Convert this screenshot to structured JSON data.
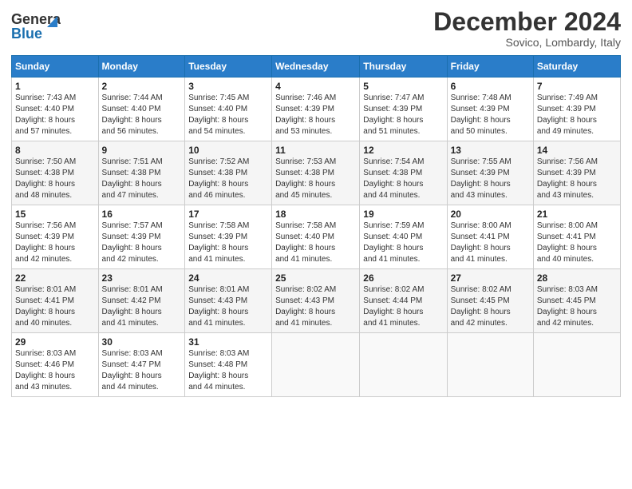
{
  "header": {
    "logo_line1": "General",
    "logo_line2": "Blue",
    "month_title": "December 2024",
    "location": "Sovico, Lombardy, Italy"
  },
  "days_of_week": [
    "Sunday",
    "Monday",
    "Tuesday",
    "Wednesday",
    "Thursday",
    "Friday",
    "Saturday"
  ],
  "weeks": [
    [
      {
        "day": "1",
        "info": "Sunrise: 7:43 AM\nSunset: 4:40 PM\nDaylight: 8 hours\nand 57 minutes."
      },
      {
        "day": "2",
        "info": "Sunrise: 7:44 AM\nSunset: 4:40 PM\nDaylight: 8 hours\nand 56 minutes."
      },
      {
        "day": "3",
        "info": "Sunrise: 7:45 AM\nSunset: 4:40 PM\nDaylight: 8 hours\nand 54 minutes."
      },
      {
        "day": "4",
        "info": "Sunrise: 7:46 AM\nSunset: 4:39 PM\nDaylight: 8 hours\nand 53 minutes."
      },
      {
        "day": "5",
        "info": "Sunrise: 7:47 AM\nSunset: 4:39 PM\nDaylight: 8 hours\nand 51 minutes."
      },
      {
        "day": "6",
        "info": "Sunrise: 7:48 AM\nSunset: 4:39 PM\nDaylight: 8 hours\nand 50 minutes."
      },
      {
        "day": "7",
        "info": "Sunrise: 7:49 AM\nSunset: 4:39 PM\nDaylight: 8 hours\nand 49 minutes."
      }
    ],
    [
      {
        "day": "8",
        "info": "Sunrise: 7:50 AM\nSunset: 4:38 PM\nDaylight: 8 hours\nand 48 minutes."
      },
      {
        "day": "9",
        "info": "Sunrise: 7:51 AM\nSunset: 4:38 PM\nDaylight: 8 hours\nand 47 minutes."
      },
      {
        "day": "10",
        "info": "Sunrise: 7:52 AM\nSunset: 4:38 PM\nDaylight: 8 hours\nand 46 minutes."
      },
      {
        "day": "11",
        "info": "Sunrise: 7:53 AM\nSunset: 4:38 PM\nDaylight: 8 hours\nand 45 minutes."
      },
      {
        "day": "12",
        "info": "Sunrise: 7:54 AM\nSunset: 4:38 PM\nDaylight: 8 hours\nand 44 minutes."
      },
      {
        "day": "13",
        "info": "Sunrise: 7:55 AM\nSunset: 4:39 PM\nDaylight: 8 hours\nand 43 minutes."
      },
      {
        "day": "14",
        "info": "Sunrise: 7:56 AM\nSunset: 4:39 PM\nDaylight: 8 hours\nand 43 minutes."
      }
    ],
    [
      {
        "day": "15",
        "info": "Sunrise: 7:56 AM\nSunset: 4:39 PM\nDaylight: 8 hours\nand 42 minutes."
      },
      {
        "day": "16",
        "info": "Sunrise: 7:57 AM\nSunset: 4:39 PM\nDaylight: 8 hours\nand 42 minutes."
      },
      {
        "day": "17",
        "info": "Sunrise: 7:58 AM\nSunset: 4:39 PM\nDaylight: 8 hours\nand 41 minutes."
      },
      {
        "day": "18",
        "info": "Sunrise: 7:58 AM\nSunset: 4:40 PM\nDaylight: 8 hours\nand 41 minutes."
      },
      {
        "day": "19",
        "info": "Sunrise: 7:59 AM\nSunset: 4:40 PM\nDaylight: 8 hours\nand 41 minutes."
      },
      {
        "day": "20",
        "info": "Sunrise: 8:00 AM\nSunset: 4:41 PM\nDaylight: 8 hours\nand 41 minutes."
      },
      {
        "day": "21",
        "info": "Sunrise: 8:00 AM\nSunset: 4:41 PM\nDaylight: 8 hours\nand 40 minutes."
      }
    ],
    [
      {
        "day": "22",
        "info": "Sunrise: 8:01 AM\nSunset: 4:41 PM\nDaylight: 8 hours\nand 40 minutes."
      },
      {
        "day": "23",
        "info": "Sunrise: 8:01 AM\nSunset: 4:42 PM\nDaylight: 8 hours\nand 41 minutes."
      },
      {
        "day": "24",
        "info": "Sunrise: 8:01 AM\nSunset: 4:43 PM\nDaylight: 8 hours\nand 41 minutes."
      },
      {
        "day": "25",
        "info": "Sunrise: 8:02 AM\nSunset: 4:43 PM\nDaylight: 8 hours\nand 41 minutes."
      },
      {
        "day": "26",
        "info": "Sunrise: 8:02 AM\nSunset: 4:44 PM\nDaylight: 8 hours\nand 41 minutes."
      },
      {
        "day": "27",
        "info": "Sunrise: 8:02 AM\nSunset: 4:45 PM\nDaylight: 8 hours\nand 42 minutes."
      },
      {
        "day": "28",
        "info": "Sunrise: 8:03 AM\nSunset: 4:45 PM\nDaylight: 8 hours\nand 42 minutes."
      }
    ],
    [
      {
        "day": "29",
        "info": "Sunrise: 8:03 AM\nSunset: 4:46 PM\nDaylight: 8 hours\nand 43 minutes."
      },
      {
        "day": "30",
        "info": "Sunrise: 8:03 AM\nSunset: 4:47 PM\nDaylight: 8 hours\nand 44 minutes."
      },
      {
        "day": "31",
        "info": "Sunrise: 8:03 AM\nSunset: 4:48 PM\nDaylight: 8 hours\nand 44 minutes."
      },
      null,
      null,
      null,
      null
    ]
  ]
}
